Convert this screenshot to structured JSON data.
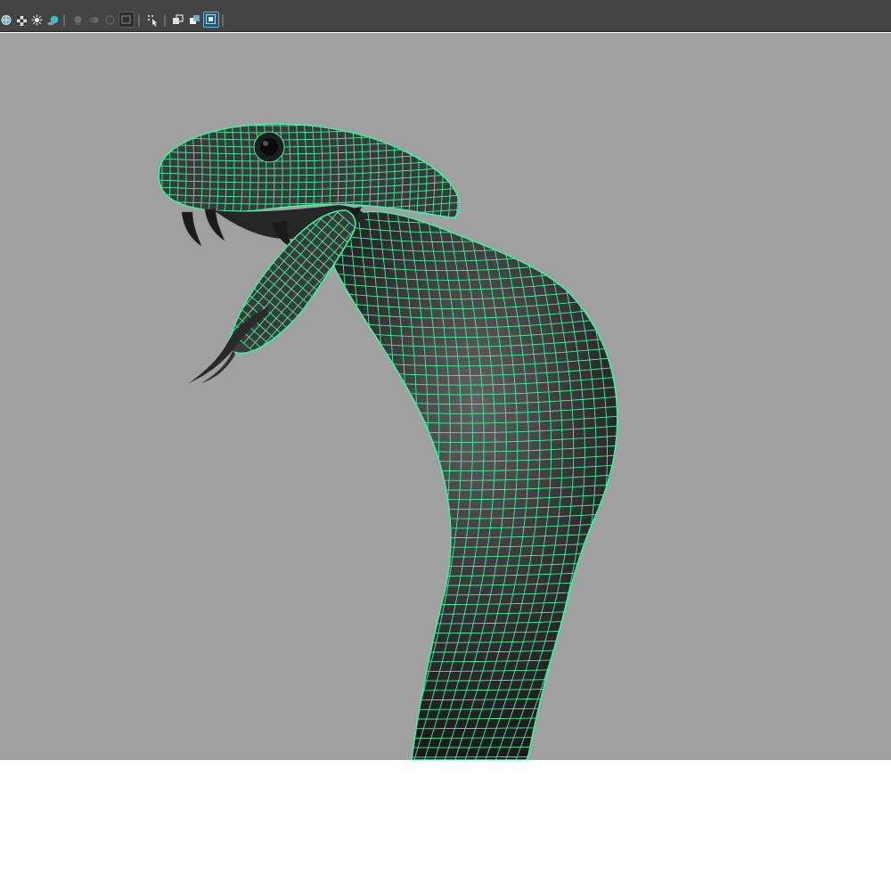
{
  "toolbar": {
    "tools": [
      {
        "icon": "lighting-sphere-icon",
        "state": "normal"
      },
      {
        "icon": "checker-texture-icon",
        "state": "normal"
      },
      {
        "icon": "light-bulb-icon",
        "state": "normal"
      },
      {
        "icon": "shadow-sphere-icon",
        "state": "normal"
      },
      {
        "icon": "screen-space-ao-icon",
        "state": "dimmed"
      },
      {
        "icon": "motion-blur-icon",
        "state": "dimmed"
      },
      {
        "icon": "anti-alias-icon",
        "state": "dimmed"
      },
      {
        "icon": "depth-of-field-icon",
        "state": "normal"
      },
      {
        "icon": "select-camera-icon",
        "state": "normal"
      },
      {
        "icon": "isolate-select-icon",
        "state": "normal"
      },
      {
        "icon": "xray-icon",
        "state": "normal"
      },
      {
        "icon": "wireframe-on-shaded-icon",
        "state": "active"
      }
    ]
  },
  "viewport": {
    "background_color": "#a0a0a0",
    "wire_color": "#3ef0a0",
    "shade_color": "#4a4a4a",
    "model": "cobra-wireframe-on-shaded"
  }
}
